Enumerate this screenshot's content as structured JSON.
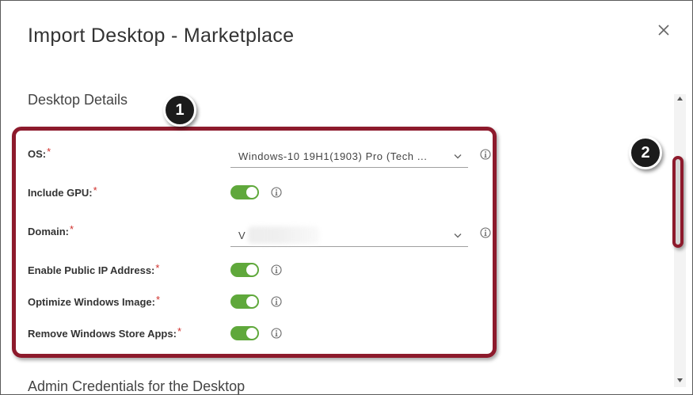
{
  "dialog": {
    "title": "Import Desktop - Marketplace",
    "close_icon": "close-icon"
  },
  "section_desktop_details": {
    "title": "Desktop Details"
  },
  "fields": {
    "os": {
      "label": "OS:",
      "required_mark": "*",
      "value": "Windows-10 19H1(1903) Pro (Tech ..."
    },
    "include_gpu": {
      "label": "Include GPU:",
      "required_mark": "*",
      "enabled": true
    },
    "domain": {
      "label": "Domain:",
      "required_mark": "*",
      "value": "V"
    },
    "enable_public_ip": {
      "label": "Enable Public IP Address:",
      "required_mark": "*",
      "enabled": true
    },
    "optimize_windows_image": {
      "label": "Optimize Windows Image:",
      "required_mark": "*",
      "enabled": true
    },
    "remove_store_apps": {
      "label": "Remove Windows Store Apps:",
      "required_mark": "*",
      "enabled": true
    }
  },
  "section_admin_credentials": {
    "title": "Admin Credentials for the Desktop"
  },
  "annotations": {
    "callout_1": "1",
    "callout_2": "2"
  },
  "colors": {
    "toggle_on": "#5fa83b",
    "required": "#d0302c",
    "annotation_border": "#8d1a2c"
  }
}
